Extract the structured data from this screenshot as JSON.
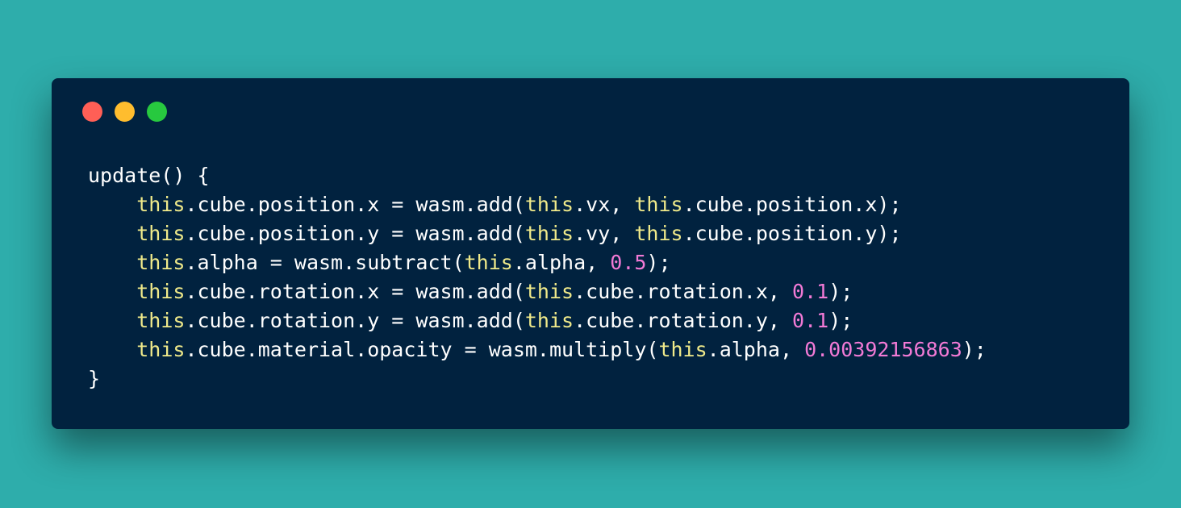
{
  "window": {
    "buttons": [
      {
        "name": "close",
        "color": "#ff5f56"
      },
      {
        "name": "minimize",
        "color": "#ffbd2e"
      },
      {
        "name": "maximize",
        "color": "#27c93f"
      }
    ]
  },
  "colors": {
    "background": "#2eadab",
    "editor": "#01223f",
    "text": "#ffffff",
    "keyword": "#f0ea8a",
    "number": "#f27ad6"
  },
  "code": {
    "language": "javascript",
    "lines": [
      [
        {
          "t": "plain",
          "v": "update() {"
        }
      ],
      [
        {
          "t": "plain",
          "v": "    "
        },
        {
          "t": "keyword",
          "v": "this"
        },
        {
          "t": "plain",
          "v": ".cube.position.x = wasm.add("
        },
        {
          "t": "keyword",
          "v": "this"
        },
        {
          "t": "plain",
          "v": ".vx, "
        },
        {
          "t": "keyword",
          "v": "this"
        },
        {
          "t": "plain",
          "v": ".cube.position.x);"
        }
      ],
      [
        {
          "t": "plain",
          "v": "    "
        },
        {
          "t": "keyword",
          "v": "this"
        },
        {
          "t": "plain",
          "v": ".cube.position.y = wasm.add("
        },
        {
          "t": "keyword",
          "v": "this"
        },
        {
          "t": "plain",
          "v": ".vy, "
        },
        {
          "t": "keyword",
          "v": "this"
        },
        {
          "t": "plain",
          "v": ".cube.position.y);"
        }
      ],
      [
        {
          "t": "plain",
          "v": "    "
        },
        {
          "t": "keyword",
          "v": "this"
        },
        {
          "t": "plain",
          "v": ".alpha = wasm.subtract("
        },
        {
          "t": "keyword",
          "v": "this"
        },
        {
          "t": "plain",
          "v": ".alpha, "
        },
        {
          "t": "number",
          "v": "0.5"
        },
        {
          "t": "plain",
          "v": ");"
        }
      ],
      [
        {
          "t": "plain",
          "v": "    "
        },
        {
          "t": "keyword",
          "v": "this"
        },
        {
          "t": "plain",
          "v": ".cube.rotation.x = wasm.add("
        },
        {
          "t": "keyword",
          "v": "this"
        },
        {
          "t": "plain",
          "v": ".cube.rotation.x, "
        },
        {
          "t": "number",
          "v": "0.1"
        },
        {
          "t": "plain",
          "v": ");"
        }
      ],
      [
        {
          "t": "plain",
          "v": "    "
        },
        {
          "t": "keyword",
          "v": "this"
        },
        {
          "t": "plain",
          "v": ".cube.rotation.y = wasm.add("
        },
        {
          "t": "keyword",
          "v": "this"
        },
        {
          "t": "plain",
          "v": ".cube.rotation.y, "
        },
        {
          "t": "number",
          "v": "0.1"
        },
        {
          "t": "plain",
          "v": ");"
        }
      ],
      [
        {
          "t": "plain",
          "v": "    "
        },
        {
          "t": "keyword",
          "v": "this"
        },
        {
          "t": "plain",
          "v": ".cube.material.opacity = wasm.multiply("
        },
        {
          "t": "keyword",
          "v": "this"
        },
        {
          "t": "plain",
          "v": ".alpha, "
        },
        {
          "t": "number",
          "v": "0.00392156863"
        },
        {
          "t": "plain",
          "v": ");"
        }
      ],
      [
        {
          "t": "plain",
          "v": "}"
        }
      ]
    ]
  }
}
